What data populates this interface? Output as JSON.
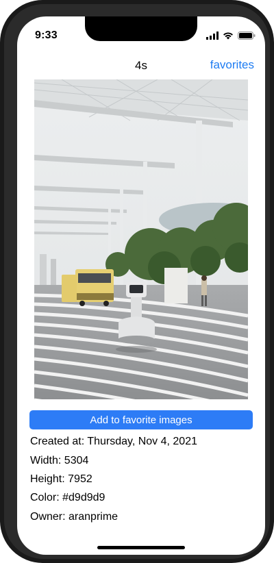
{
  "status_bar": {
    "time": "9:33"
  },
  "nav": {
    "title": "4s",
    "right_button": "favorites"
  },
  "photo": {
    "alt": "Robot on a striped plaza under a canopy with a tram"
  },
  "actions": {
    "add_favorite": "Add to favorite images"
  },
  "details": {
    "created": "Created at: Thursday, Nov 4, 2021",
    "width": "Width: 5304",
    "height": "Height: 7952",
    "color": "Color: #d9d9d9",
    "owner": "Owner: aranprime"
  },
  "colors": {
    "accent": "#2d7cf6",
    "link": "#1e7cf2",
    "image_color": "#d9d9d9"
  }
}
